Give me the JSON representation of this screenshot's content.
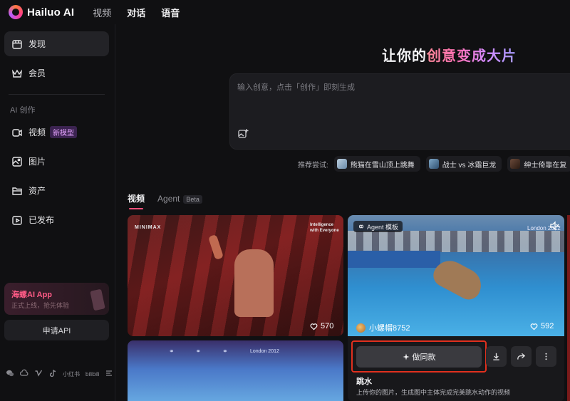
{
  "brand": {
    "name": "Hailuo AI"
  },
  "topnav": [
    "视频",
    "对话",
    "语音"
  ],
  "sidebar": {
    "items": [
      {
        "label": "发现",
        "icon": "calendar-icon"
      },
      {
        "label": "会员",
        "icon": "crown-icon"
      }
    ],
    "section_label": "AI 创作",
    "create_items": [
      {
        "label": "视频",
        "icon": "video-icon",
        "badge": "新模型"
      },
      {
        "label": "图片",
        "icon": "image-icon"
      },
      {
        "label": "资产",
        "icon": "folder-icon"
      },
      {
        "label": "已发布",
        "icon": "publish-icon"
      }
    ],
    "app_card": {
      "title": "海螺AI App",
      "subtitle": "正式上线，抢先体验"
    },
    "api_button": "申请API",
    "social": [
      "微信",
      "小红书",
      "bilibili"
    ]
  },
  "main": {
    "headline_prefix": "让你的",
    "headline_highlight": "创意变成大片",
    "prompt_placeholder": "输入创意，点击「创作」即刻生成",
    "suggest_label": "推荐尝试:",
    "suggestions": [
      "熊猫在雪山顶上跳舞",
      "战士 vs 冰霜巨龙",
      "绅士倚靠在复"
    ],
    "tabs": [
      {
        "label": "视频"
      },
      {
        "label": "Agent",
        "badge": "Beta"
      }
    ]
  },
  "cards": {
    "card1": {
      "brand_left": "MINIMAX",
      "brand_right": "Intelligence with Everyone",
      "likes": "570"
    },
    "card2": {
      "overlay": "London 2012"
    },
    "card3": {
      "tag_label": "Agent 模板",
      "overlay": "London 2012",
      "author": "小螺帽8752",
      "likes": "592",
      "make_button": "做同款",
      "title": "跳水",
      "description": "上传你的图片，生成图中主体完成完美跳水动作的视频"
    }
  },
  "colors": {
    "accent": "#ff4f7a",
    "highlight_box": "#e0301e",
    "background": "#101012"
  }
}
